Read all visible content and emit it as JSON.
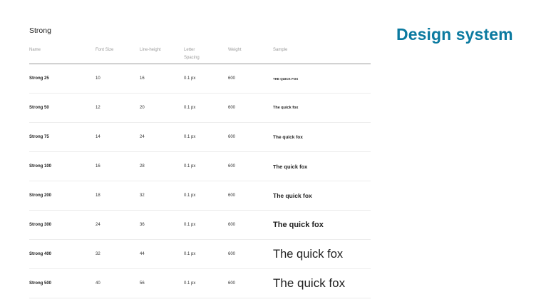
{
  "brand": "Design system",
  "section_title": "Strong",
  "columns": [
    "Name",
    "Font Size",
    "Line-height",
    "Letter Spacing",
    "Weight",
    "Sample"
  ],
  "columns_split": {
    "letter_line1": "Letter",
    "letter_line2": "Spacing"
  },
  "rows": [
    {
      "name": "Strong 25",
      "font_size": "10",
      "line_height": "16",
      "letter_spacing": "0.1 px",
      "weight": "600",
      "sample": "THE QUICK FOX"
    },
    {
      "name": "Strong 50",
      "font_size": "12",
      "line_height": "20",
      "letter_spacing": "0.1 px",
      "weight": "600",
      "sample": "The quick fox"
    },
    {
      "name": "Strong 75",
      "font_size": "14",
      "line_height": "24",
      "letter_spacing": "0.1 px",
      "weight": "600",
      "sample": "The quick fox"
    },
    {
      "name": "Strong 100",
      "font_size": "16",
      "line_height": "28",
      "letter_spacing": "0.1 px",
      "weight": "600",
      "sample": "The quick fox"
    },
    {
      "name": "Strong 200",
      "font_size": "18",
      "line_height": "32",
      "letter_spacing": "0.1 px",
      "weight": "600",
      "sample": "The quick fox"
    },
    {
      "name": "Strong 300",
      "font_size": "24",
      "line_height": "36",
      "letter_spacing": "0.1 px",
      "weight": "600",
      "sample": "The quick fox"
    },
    {
      "name": "Strong 400",
      "font_size": "32",
      "line_height": "44",
      "letter_spacing": "0.1 px",
      "weight": "600",
      "sample": "The quick fox"
    },
    {
      "name": "Strong 500",
      "font_size": "40",
      "line_height": "56",
      "letter_spacing": "0.1 px",
      "weight": "600",
      "sample": "The quick fox"
    }
  ]
}
